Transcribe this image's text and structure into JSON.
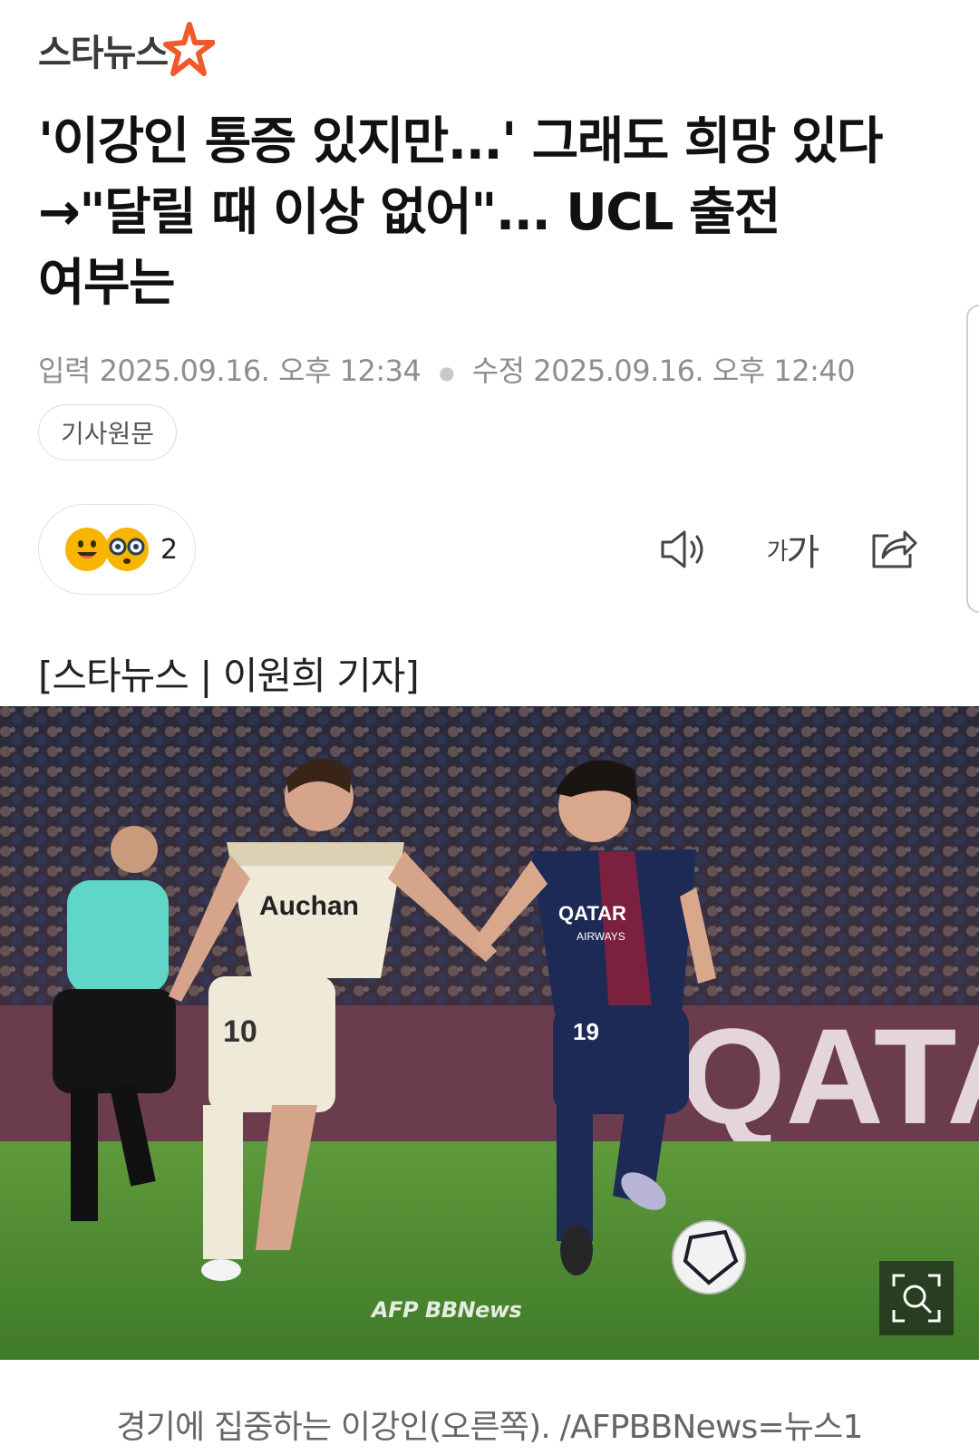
{
  "header": {
    "logo_text": "스타뉴스"
  },
  "article": {
    "title": "'이강인 통증 있지만...' 그래도 희망 있다 →\"달릴 때 이상 없어\"... UCL 출전 여부는",
    "published_label": "입력",
    "published": "2025.09.16. 오후 12:34",
    "modified_label": "수정",
    "modified": "2025.09.16. 오후 12:40",
    "origin_button": "기사원문",
    "byline": "[스타뉴스 | 이원희 기자]",
    "photo_watermark": "AFP BBNews",
    "photo_caption": "경기에 집중하는 이강인(오른쪽). /AFPBBNews=뉴스1"
  },
  "toolbar": {
    "reaction_count": "2",
    "font_small": "가",
    "font_large": "가"
  },
  "colors": {
    "logo_star": "#f05a28",
    "title": "#111111",
    "meta": "#8e8e8e",
    "psg_navy": "#1e2a56"
  }
}
